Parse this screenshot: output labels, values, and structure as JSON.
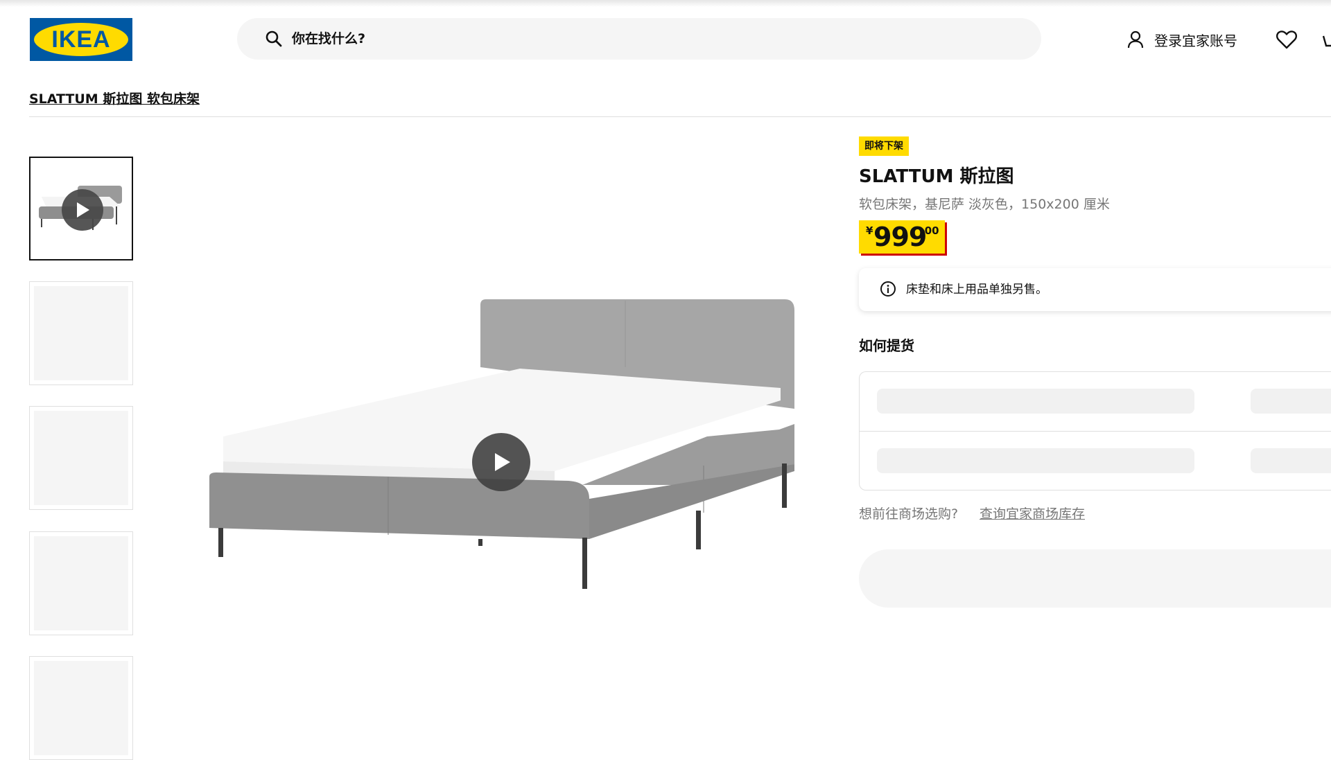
{
  "header": {
    "logo_text": "IKEA",
    "search_placeholder": "你在找什么?",
    "account_label": "登录宜家账号",
    "icons": [
      "search-icon",
      "user-icon",
      "heart-icon",
      "cart-icon"
    ]
  },
  "breadcrumb": "SLATTUM 斯拉图 软包床架",
  "gallery": {
    "thumbnails": [
      "video",
      "image",
      "image",
      "image",
      "image"
    ],
    "main_media": "video"
  },
  "product": {
    "badge": "即将下架",
    "name": "SLATTUM 斯拉图",
    "description": "软包床架，基尼萨 淡灰色，150x200 厘米",
    "price": {
      "currency": "¥",
      "integer": "999",
      "decimal": ".00"
    },
    "notice": "床垫和床上用品单独另售。",
    "delivery_title": "如何提货",
    "store_question": "想前往商场选购?",
    "store_link": "查询宜家商场库存"
  },
  "colors": {
    "ikea_blue": "#0058a3",
    "ikea_yellow": "#ffdb00",
    "price_shadow": "#cc0008",
    "muted_text": "#767676",
    "skeleton": "#f1f1f1"
  }
}
